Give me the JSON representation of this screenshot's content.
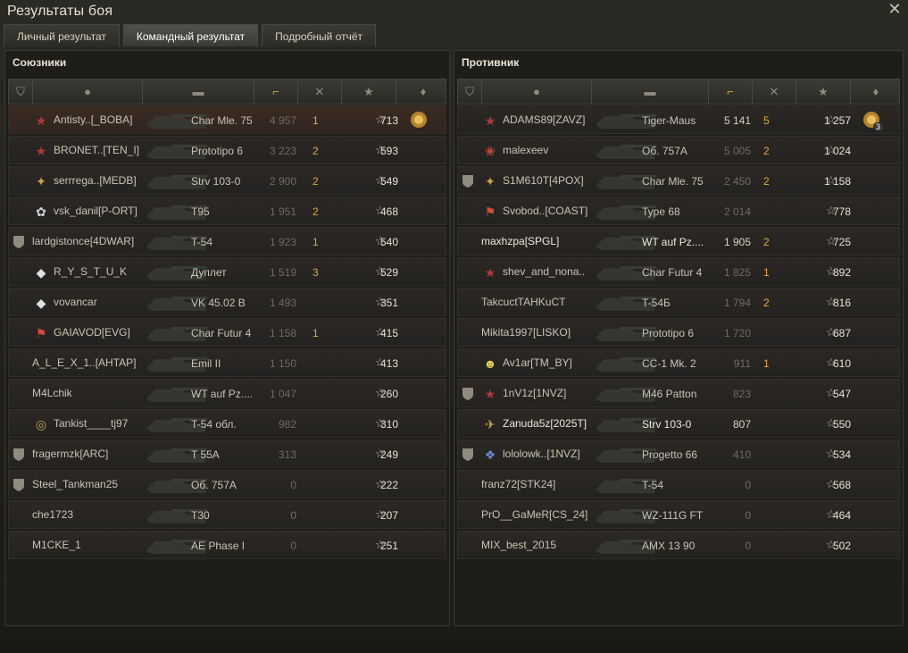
{
  "window": {
    "title": "Результаты боя"
  },
  "tabs": [
    {
      "label": "Личный результат"
    },
    {
      "label": "Командный результат"
    },
    {
      "label": "Подробный отчёт"
    }
  ],
  "allies": {
    "title": "Союзники",
    "rows": [
      {
        "name": "Antisty..[_BOBA]",
        "tank": "Char Mle. 75",
        "damage": "4 957",
        "frags": "1",
        "xp": "713",
        "badge": "rank-star-icon",
        "medal": true,
        "self": true
      },
      {
        "name": "BRONET..[TEN_I]",
        "tank": "Prototipo 6",
        "damage": "3 223",
        "frags": "2",
        "xp": "593",
        "badge": "rank-star-icon"
      },
      {
        "name": "serrrega..[MEDB]",
        "tank": "Strv 103-0",
        "damage": "2 900",
        "frags": "2",
        "xp": "549",
        "badge": "clan-emblem-icon"
      },
      {
        "name": "vsk_danil[P-ORT]",
        "tank": "T95",
        "damage": "1 951",
        "frags": "2",
        "xp": "468",
        "badge": "flower-emblem-icon"
      },
      {
        "name": "lardgistonce[4DWAR]",
        "tank": "T-54",
        "damage": "1 923",
        "frags": "1",
        "xp": "540",
        "platoon": true
      },
      {
        "name": "R_Y_S_T_U_K",
        "tank": "Дуплет",
        "damage": "1 519",
        "frags": "3",
        "xp": "529",
        "badge": "diamond-emblem-icon"
      },
      {
        "name": "vovancar",
        "tank": "VK 45.02 B",
        "damage": "1 493",
        "frags": "",
        "xp": "351",
        "badge": "diamond-emblem-icon"
      },
      {
        "name": "GAIAVOD[EVG]",
        "tank": "Char Futur 4",
        "damage": "1 158",
        "frags": "1",
        "xp": "415",
        "badge": "flag-emblem-icon"
      },
      {
        "name": "A_L_E_X_1..[AHTAP]",
        "tank": "Emil II",
        "damage": "1 150",
        "frags": "",
        "xp": "413"
      },
      {
        "name": "M4Lchik",
        "tank": "WT auf Pz....",
        "damage": "1 047",
        "frags": "",
        "xp": "260"
      },
      {
        "name": "Tankist____tj97",
        "tank": "T-54 обл.",
        "damage": "982",
        "frags": "",
        "xp": "310",
        "badge": "target-emblem-icon"
      },
      {
        "name": "fragermzk[ARC]",
        "tank": "T 55A",
        "damage": "313",
        "frags": "",
        "xp": "249",
        "platoon": true
      },
      {
        "name": "Steel_Tankman25",
        "tank": "Об. 757А",
        "damage": "0",
        "frags": "",
        "xp": "222",
        "platoon": true
      },
      {
        "name": "che1723",
        "tank": "T30",
        "damage": "0",
        "frags": "",
        "xp": "207"
      },
      {
        "name": "M1CKE_1",
        "tank": "AE Phase I",
        "damage": "0",
        "frags": "",
        "xp": "251"
      }
    ]
  },
  "enemies": {
    "title": "Противник",
    "rows": [
      {
        "name": "ADAMS89[ZAVZ]",
        "tank": "Tiger-Maus",
        "damage": "5 141",
        "frags": "5",
        "xp": "1 257",
        "badge": "rank-star-icon",
        "medal": true,
        "medal_count": "3",
        "hi": true
      },
      {
        "name": "malexeev",
        "tank": "Об. 757А",
        "damage": "5 005",
        "frags": "2",
        "xp": "1 024",
        "badge": "rose-emblem-icon"
      },
      {
        "name": "S1M610T[4POX]",
        "tank": "Char Mle. 75",
        "damage": "2 450",
        "frags": "2",
        "xp": "1 158",
        "badge": "clan-emblem-icon",
        "platoon": true
      },
      {
        "name": "Svobod..[COAST]",
        "tank": "Type 68",
        "damage": "2 014",
        "frags": "",
        "xp": "778",
        "badge": "flag-emblem-icon"
      },
      {
        "name": "maxhzpa[SPGL]",
        "tank": "WT auf Pz....",
        "damage": "1 905",
        "frags": "2",
        "xp": "725",
        "hi": true,
        "bright": true
      },
      {
        "name": "shev_and_nona..",
        "tank": "Char Futur 4",
        "damage": "1 825",
        "frags": "1",
        "xp": "892",
        "badge": "rank-star-icon"
      },
      {
        "name": "TakcuctTAHKuCT",
        "tank": "T-54Б",
        "damage": "1 794",
        "frags": "2",
        "xp": "816"
      },
      {
        "name": "Mikita1997[LISKO]",
        "tank": "Prototipo 6",
        "damage": "1 720",
        "frags": "",
        "xp": "687"
      },
      {
        "name": "Av1ar[TM_BY]",
        "tank": "CC-1 Mk. 2",
        "damage": "911",
        "frags": "1",
        "xp": "610",
        "badge": "skull-emblem-icon"
      },
      {
        "name": "1nV1z[1NVZ]",
        "tank": "M46 Patton",
        "damage": "823",
        "frags": "",
        "xp": "547",
        "badge": "rank-star-icon",
        "platoon": true
      },
      {
        "name": "Zanuda5z[2025T]",
        "tank": "Strv 103-0",
        "damage": "807",
        "frags": "",
        "xp": "550",
        "badge": "plane-emblem-icon",
        "hi": true,
        "bright": true
      },
      {
        "name": "lololowk..[1NVZ]",
        "tank": "Progetto 66",
        "damage": "410",
        "frags": "",
        "xp": "534",
        "badge": "wing-emblem-icon",
        "platoon": true
      },
      {
        "name": "franz72[STK24]",
        "tank": "T-54",
        "damage": "0",
        "frags": "",
        "xp": "568"
      },
      {
        "name": "PrO__GaMeR[CS_24]",
        "tank": "WZ-111G FT",
        "damage": "0",
        "frags": "",
        "xp": "464"
      },
      {
        "name": "MIX_best_2015",
        "tank": "AMX 13 90",
        "damage": "0",
        "frags": "",
        "xp": "502"
      }
    ]
  },
  "icons": {
    "close": "close-icon",
    "columns": [
      "platoon-icon",
      "player-icon",
      "tank-icon",
      "damage-icon",
      "frags-icon",
      "xp-star-icon",
      "medal-icon"
    ]
  },
  "colors": {
    "frags": "#e2a83e",
    "self_row": "#3b2b22",
    "accent": "#e7e3d4"
  }
}
